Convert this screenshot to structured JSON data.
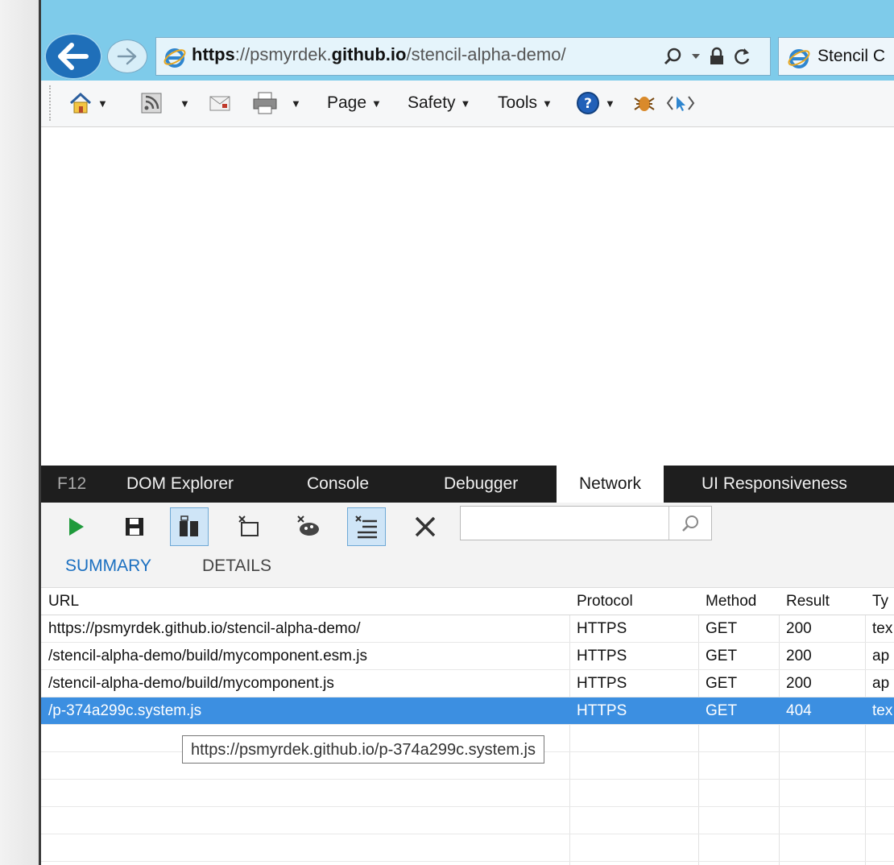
{
  "browser": {
    "address": {
      "scheme": "https",
      "separator": "://",
      "host_sub": "psmyrdek.",
      "host_main": "github.io",
      "path": "/stencil-alpha-demo/"
    },
    "tab": {
      "label": "Stencil C"
    }
  },
  "commandbar": {
    "page_label": "Page",
    "safety_label": "Safety",
    "tools_label": "Tools"
  },
  "f12": {
    "tabs": [
      "F12",
      "DOM Explorer",
      "Console",
      "Debugger",
      "Network",
      "UI Responsiveness"
    ],
    "search": {
      "value": "",
      "placeholder": ""
    },
    "subtabs": {
      "summary": "SUMMARY",
      "details": "DETAILS"
    },
    "columns": {
      "url": "URL",
      "protocol": "Protocol",
      "method": "Method",
      "result": "Result",
      "type": "Ty"
    },
    "rows": [
      {
        "url": "https://psmyrdek.github.io/stencil-alpha-demo/",
        "protocol": "HTTPS",
        "method": "GET",
        "result": "200",
        "type": "tex"
      },
      {
        "url": "/stencil-alpha-demo/build/mycomponent.esm.js",
        "protocol": "HTTPS",
        "method": "GET",
        "result": "200",
        "type": "ap"
      },
      {
        "url": "/stencil-alpha-demo/build/mycomponent.js",
        "protocol": "HTTPS",
        "method": "GET",
        "result": "200",
        "type": "ap"
      },
      {
        "url": "/p-374a299c.system.js",
        "protocol": "HTTPS",
        "method": "GET",
        "result": "404",
        "type": "tex"
      }
    ],
    "tooltip": "https://psmyrdek.github.io/p-374a299c.system.js"
  },
  "colors": {
    "accent": "#3c8fe1",
    "titlebar": "#7ecbea",
    "devtools_tabs": "#1e1e1e"
  },
  "icons": [
    "back-arrow-icon",
    "forward-arrow-icon",
    "ie-logo-icon",
    "search-icon",
    "lock-icon",
    "refresh-icon",
    "home-icon",
    "rss-feed-icon",
    "read-mail-icon",
    "print-icon",
    "help-icon",
    "bug-icon",
    "developer-tools-icon",
    "play-icon",
    "save-icon",
    "export-icon",
    "clear-on-navigate-icon",
    "clear-cache-icon",
    "always-refresh-icon",
    "clear-icon"
  ]
}
